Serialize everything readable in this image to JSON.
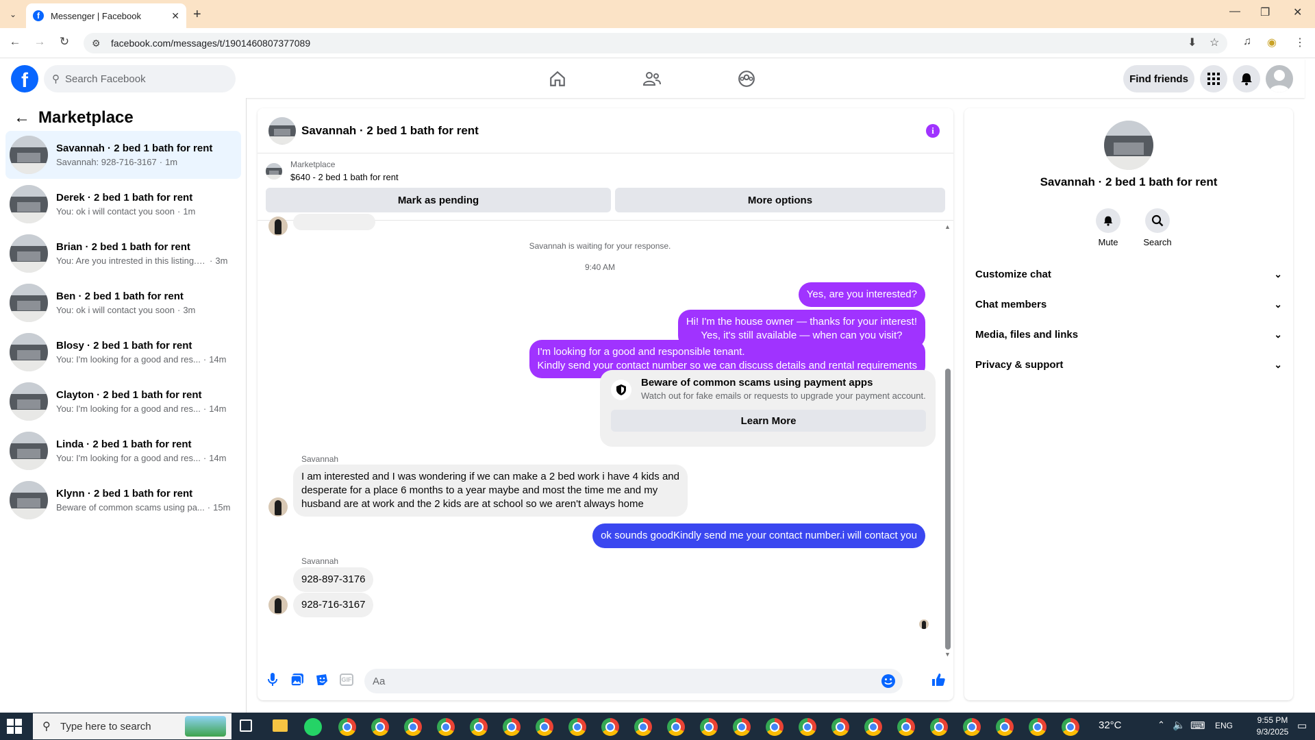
{
  "browser": {
    "tab_title": "Messenger | Facebook",
    "url": "facebook.com/messages/t/1901460807377089"
  },
  "fb": {
    "search_placeholder": "Search Facebook",
    "find_friends": "Find friends"
  },
  "sidebar": {
    "title": "Marketplace",
    "conversations": [
      {
        "name": "Savannah · 2 bed 1 bath for rent",
        "preview": "Savannah: 928-716-3167",
        "time": "1m",
        "active": true
      },
      {
        "name": "Derek · 2 bed 1 bath for rent",
        "preview": "You: ok i will contact you soon",
        "time": "1m"
      },
      {
        "name": "Brian · 2 bed 1 bath for rent",
        "preview": "You: Are you intrested in this listing.k...",
        "time": "3m"
      },
      {
        "name": "Ben · 2 bed 1 bath for rent",
        "preview": "You: ok i will contact you soon",
        "time": "3m"
      },
      {
        "name": "Blosy · 2 bed 1 bath for rent",
        "preview": "You: I'm looking for a good and res...",
        "time": "14m"
      },
      {
        "name": "Clayton · 2 bed 1 bath for rent",
        "preview": "You: I'm looking for a good and res...",
        "time": "14m"
      },
      {
        "name": "Linda · 2 bed 1 bath for rent",
        "preview": "You: I'm looking for a good and res...",
        "time": "14m"
      },
      {
        "name": "Klynn · 2 bed 1 bath for rent",
        "preview": "Beware of common scams using pa...",
        "time": "15m"
      }
    ]
  },
  "chat": {
    "title": "Savannah · 2 bed 1 bath for rent",
    "marketplace_label": "Marketplace",
    "listing": "$640 - 2 bed 1 bath for rent",
    "mark_pending": "Mark as pending",
    "more_options": "More options",
    "waiting": "Savannah is waiting for your response.",
    "timestamp": "9:40 AM",
    "out1": "Yes, are you interested?",
    "out2_l1": "Hi! I'm the house owner — thanks for your interest!",
    "out2_l2": "Yes, it's still available — when can you visit?",
    "out3_l1": "I'm looking for a good and responsible tenant.",
    "out3_l2": "Kindly send your contact number so we can discuss details and rental requirements",
    "scam_title": "Beware of common scams using payment apps",
    "scam_sub": "Watch out for fake emails or requests to upgrade your payment account.",
    "learn_more": "Learn More",
    "sender": "Savannah",
    "in1_l1": "I am interested and I was wondering if we can make a 2 bed work i have 4 kids and",
    "in1_l2": "desperate for a place 6 months to a year maybe and most the time me and my",
    "in1_l3": "husband are at work and the 2 kids are at school so we aren't always home",
    "out4": "ok sounds goodKindly send me your contact number.i will contact you",
    "in2": "928-897-3176",
    "in3": "928-716-3167",
    "composer_placeholder": "Aa",
    "gif_label": "GIF"
  },
  "details": {
    "name": "Savannah · 2 bed 1 bath for rent",
    "mute": "Mute",
    "search": "Search",
    "sections": [
      "Customize chat",
      "Chat members",
      "Media, files and links",
      "Privacy & support"
    ]
  },
  "taskbar": {
    "search_placeholder": "Type here to search",
    "temperature": "32°C",
    "lang": "ENG",
    "time": "9:55 PM",
    "date": "9/3/2025"
  }
}
